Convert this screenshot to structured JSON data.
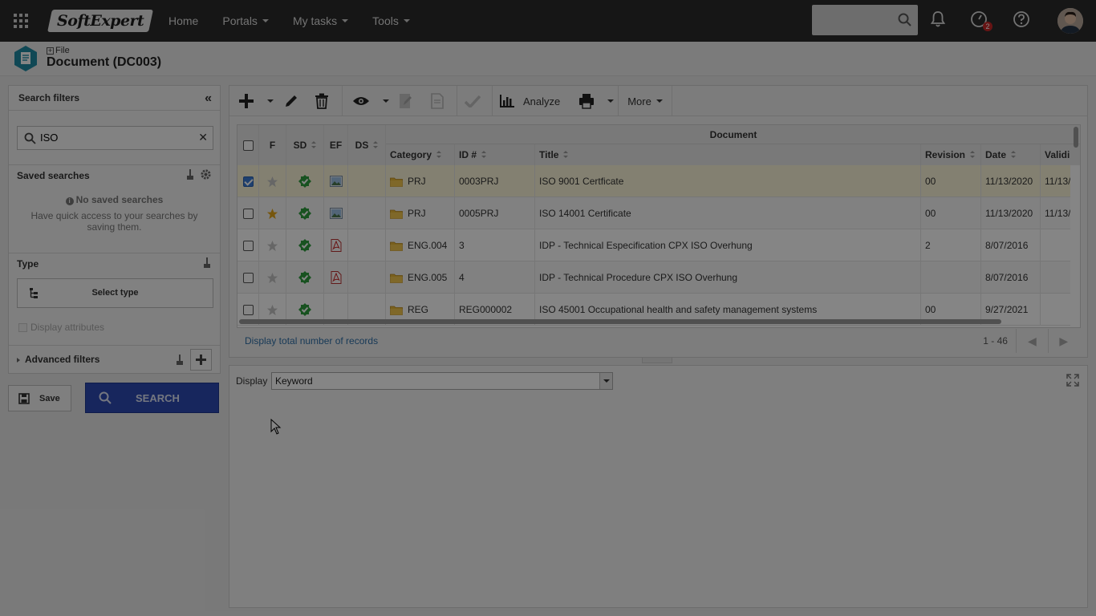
{
  "topbar": {
    "logo_text": "SoftExpert",
    "nav": [
      {
        "label": "Home",
        "has_caret": false
      },
      {
        "label": "Portals",
        "has_caret": true
      },
      {
        "label": "My tasks",
        "has_caret": true
      },
      {
        "label": "Tools",
        "has_caret": true
      }
    ],
    "search_placeholder": "",
    "notification_badge": "2"
  },
  "header": {
    "breadcrumb": "File",
    "title": "Document (DC003)"
  },
  "filters": {
    "title": "Search filters",
    "search_value": "ISO",
    "saved_searches": {
      "title": "Saved searches",
      "empty_title": "No saved searches",
      "empty_text_line1": "Have quick access to your searches by",
      "empty_text_line2": "saving them."
    },
    "type": {
      "title": "Type",
      "select_label": "Select type",
      "display_attributes": "Display attributes"
    },
    "advanced_label": "Advanced filters",
    "save_label": "Save",
    "search_label": "SEARCH"
  },
  "toolbar": {
    "analyze_label": "Analyze",
    "more_label": "More"
  },
  "grid": {
    "group_header": "Document",
    "columns": [
      "F",
      "SD",
      "EF",
      "DS",
      "Category",
      "ID #",
      "Title",
      "Revision",
      "Date",
      "Validi"
    ],
    "rows": [
      {
        "checked": true,
        "starred": false,
        "file": "image",
        "category": "PRJ",
        "id": "0003PRJ",
        "title": "ISO 9001 Certficate",
        "revision": "00",
        "date": "11/13/2020",
        "validity": "11/13/"
      },
      {
        "checked": false,
        "starred": true,
        "file": "image",
        "category": "PRJ",
        "id": "0005PRJ",
        "title": "ISO 14001 Certificate",
        "revision": "00",
        "date": "11/13/2020",
        "validity": "11/13/"
      },
      {
        "checked": false,
        "starred": false,
        "file": "pdf",
        "category": "ENG.004",
        "id": "3",
        "title": "IDP - Technical Especification CPX ISO Overhung",
        "revision": "2",
        "date": "8/07/2016",
        "validity": ""
      },
      {
        "checked": false,
        "starred": false,
        "file": "pdf",
        "category": "ENG.005",
        "id": "4",
        "title": "IDP - Technical Procedure CPX ISO Overhung",
        "revision": "",
        "date": "8/07/2016",
        "validity": ""
      },
      {
        "checked": false,
        "starred": false,
        "file": "",
        "category": "REG",
        "id": "REG000002",
        "title": "ISO 45001 Occupational health and safety management systems",
        "revision": "00",
        "date": "9/27/2021",
        "validity": ""
      }
    ],
    "footer_link": "Display total number of records",
    "pager_text": "1 - 46"
  },
  "bottom": {
    "display_label": "Display",
    "display_value": "Keyword"
  },
  "colors": {
    "topbar": "#2b2b2b",
    "search_button": "#2c49b3",
    "selected_row": "#fbf6d9",
    "check_green": "#2e9e3f",
    "star_gold": "#e3a51a",
    "folder_yellow": "#e8b838",
    "link_blue": "#2f6fa8"
  }
}
